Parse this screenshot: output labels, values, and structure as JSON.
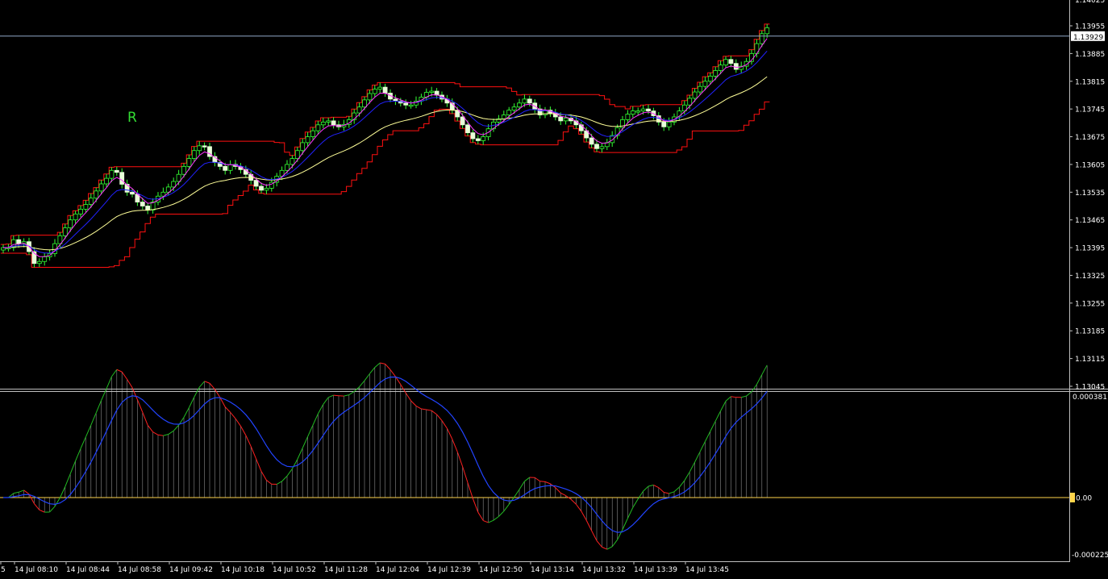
{
  "colors": {
    "background": "#000000",
    "frame": "#c0c0c0",
    "tick_text": "#ffffff",
    "candle_up_body": "#000000",
    "candle_up_wick": "#33ff33",
    "candle_down_body": "#e8ffd8",
    "fast_ma": "#ff33ff",
    "mid_ma": "#2222ff",
    "slow_ma": "#ffff99",
    "channel": "#ff1010",
    "bid_line": "#8fa7c8",
    "bid_label_bg": "#ffffff",
    "bid_label_text": "#000000",
    "macd_hist": "#c8c8c8",
    "macd_up": "#22bb22",
    "macd_down": "#ff2020",
    "macd_signal": "#2244ff",
    "zero_line": "#ffd54a",
    "marker": "#33dd33"
  },
  "marker_label": "R",
  "price_axis": {
    "ticks": [
      "1.13955",
      "1.13885",
      "1.13815",
      "1.13745",
      "1.13675",
      "1.13605",
      "1.13535",
      "1.13465",
      "1.13395",
      "1.13325",
      "1.13255",
      "1.13185",
      "1.13115",
      "1.13045"
    ],
    "top_partial": "1.14025",
    "current_price": "1.13929"
  },
  "indicator_axis": {
    "top_label": "0.000381",
    "zero_label": "0.00",
    "bottom_label": "-0.000225"
  },
  "time_axis": {
    "labels": [
      "5",
      "14 Jul 08:10",
      "14 Jul 08:44",
      "14 Jul 08:58",
      "14 Jul 09:42",
      "14 Jul 10:18",
      "14 Jul 10:52",
      "14 Jul 11:28",
      "14 Jul 12:04",
      "14 Jul 12:39",
      "14 Jul 12:50",
      "14 Jul 13:14",
      "14 Jul 13:32",
      "14 Jul 13:39",
      "14 Jul 13:45"
    ]
  },
  "chart_data": [
    {
      "type": "candlestick",
      "x_label_every_n_bars": 8,
      "ylim": [
        1.1301,
        1.1405
      ],
      "close": [
        1.13395,
        1.13395,
        1.13415,
        1.13405,
        1.1341,
        1.13385,
        1.13355,
        1.1336,
        1.13372,
        1.1338,
        1.13405,
        1.13425,
        1.13445,
        1.13465,
        1.1348,
        1.13492,
        1.13504,
        1.1352,
        1.13538,
        1.13556,
        1.1357,
        1.1359,
        1.13585,
        1.13555,
        1.13535,
        1.1353,
        1.1351,
        1.135,
        1.1349,
        1.1351,
        1.13525,
        1.13535,
        1.13548,
        1.13562,
        1.1358,
        1.136,
        1.1362,
        1.1364,
        1.13652,
        1.1365,
        1.13625,
        1.1361,
        1.136,
        1.1359,
        1.13605,
        1.136,
        1.13592,
        1.1358,
        1.13565,
        1.1355,
        1.1354,
        1.13545,
        1.1356,
        1.13575,
        1.1359,
        1.13605,
        1.1362,
        1.1364,
        1.1366,
        1.13675,
        1.1369,
        1.13705,
        1.13712,
        1.13715,
        1.13705,
        1.137,
        1.13706,
        1.13718,
        1.13735,
        1.1375,
        1.13768,
        1.13784,
        1.13795,
        1.138,
        1.13785,
        1.1377,
        1.13765,
        1.1376,
        1.13755,
        1.13755,
        1.13765,
        1.13775,
        1.13787,
        1.1379,
        1.1378,
        1.1377,
        1.1376,
        1.13742,
        1.13725,
        1.13705,
        1.13685,
        1.1367,
        1.13665,
        1.13675,
        1.13695,
        1.13712,
        1.1372,
        1.1373,
        1.13742,
        1.1375,
        1.1376,
        1.1377,
        1.1376,
        1.13745,
        1.1373,
        1.13742,
        1.13735,
        1.13725,
        1.13715,
        1.13722,
        1.13715,
        1.13705,
        1.1369,
        1.13672,
        1.13656,
        1.13645,
        1.1365,
        1.1366,
        1.13678,
        1.13698,
        1.13718,
        1.13732,
        1.1374,
        1.1374,
        1.13745,
        1.1374,
        1.13728,
        1.13712,
        1.137,
        1.13712,
        1.13725,
        1.1374,
        1.13755,
        1.13772,
        1.13788,
        1.13802,
        1.13815,
        1.13828,
        1.13842,
        1.13856,
        1.1387,
        1.1386,
        1.13845,
        1.13853,
        1.13865,
        1.13885,
        1.1391,
        1.13935,
        1.1395
      ],
      "y_tick_labels": [
        "1.13955",
        "1.13885",
        "1.13815",
        "1.13745",
        "1.13675",
        "1.13605",
        "1.13535",
        "1.13465",
        "1.13395",
        "1.13325",
        "1.13255",
        "1.13185",
        "1.13115",
        "1.13045"
      ],
      "current_price": 1.13929,
      "x_tick_labels": [
        "5",
        "14 Jul 08:10",
        "14 Jul 08:44",
        "14 Jul 08:58",
        "14 Jul 09:42",
        "14 Jul 10:18",
        "14 Jul 10:52",
        "14 Jul 11:28",
        "14 Jul 12:04",
        "14 Jul 12:39",
        "14 Jul 12:50",
        "14 Jul 13:14",
        "14 Jul 13:32",
        "14 Jul 13:39",
        "14 Jul 13:45"
      ],
      "overlays": [
        "fast moving average",
        "mid moving average",
        "slow moving average",
        "price channel"
      ],
      "grid": false
    },
    {
      "type": "macd",
      "y_tick_labels": [
        "0.000381",
        "0.00",
        "-0.000225"
      ],
      "ylim": [
        -0.000225,
        0.000381
      ],
      "bars_shown": "histogram with colored main line and signal line",
      "grid": false
    }
  ]
}
